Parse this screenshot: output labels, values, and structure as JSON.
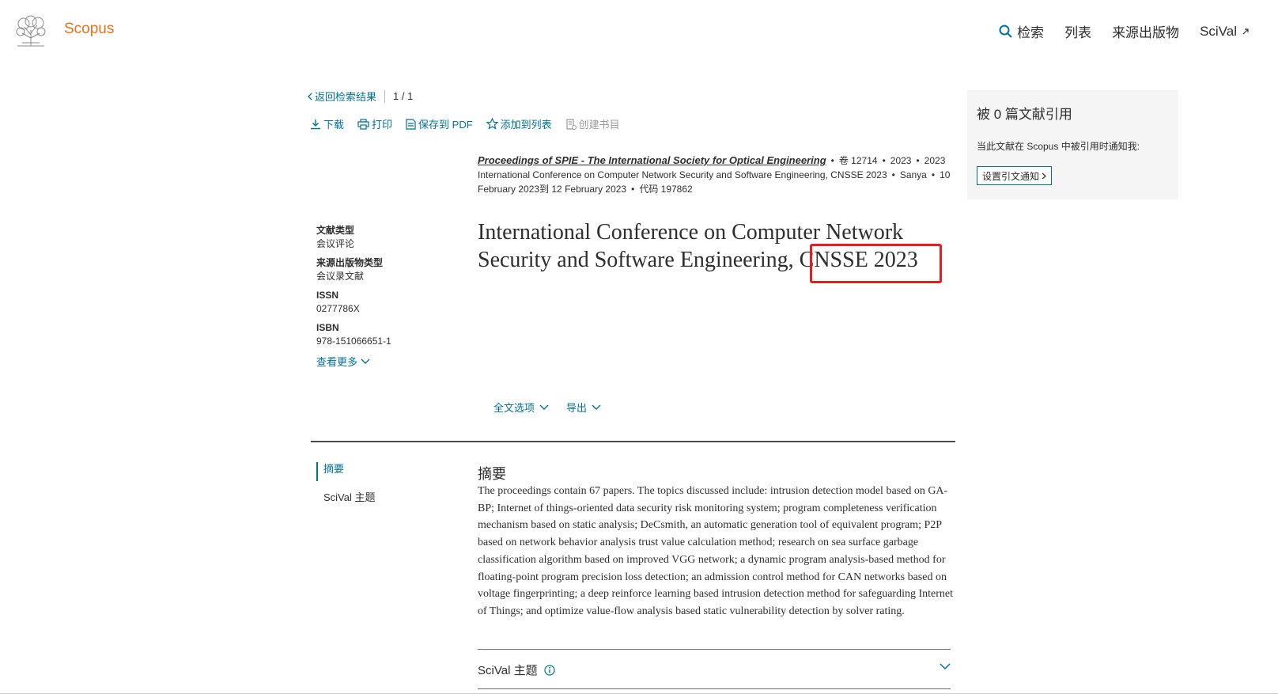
{
  "header": {
    "brand": "Scopus",
    "nav": {
      "search": "检索",
      "lists": "列表",
      "sources": "来源出版物",
      "scival": "SciVal"
    }
  },
  "back": {
    "label": "返回检索结果",
    "pager": "1 / 1"
  },
  "toolbar": {
    "download": "下载",
    "print": "打印",
    "save_pdf": "保存到 PDF",
    "add_list": "添加到列表",
    "create_bib": "创建书目"
  },
  "source": {
    "journal": "Proceedings of SPIE - The International Society for Optical Engineering",
    "volume": "卷 12714",
    "year1": "2023",
    "year2": "2023",
    "conference": "International Conference on Computer Network Security and Software Engineering, CNSSE 2023",
    "location": "Sanya",
    "dates": "10 February 2023到 12 February 2023",
    "code": "代码 197862"
  },
  "meta": {
    "doc_type_label": "文献类型",
    "doc_type": "会议评论",
    "source_type_label": "来源出版物类型",
    "source_type": "会议录文献",
    "issn_label": "ISSN",
    "issn": "0277786X",
    "isbn_label": "ISBN",
    "isbn": "978-151066651-1",
    "more": "查看更多"
  },
  "title": {
    "part1": "International Conference on Computer Network Security and Software Engineering, ",
    "highlight": "CNSSE 2023"
  },
  "options": {
    "fulltext": "全文选项",
    "export": "导出"
  },
  "sidenav": {
    "abstract": "摘要",
    "scival": "SciVal 主题"
  },
  "abstract": {
    "heading": "摘要",
    "text": "The proceedings contain 67 papers. The topics discussed include: intrusion detection model based on GA-BP; Internet of things-oriented data security risk monitoring system; program completeness verification mechanism based on static analysis; DeCsmith, an automatic generation tool of equivalent program; P2P based on network behavior analysis trust value calculation method; research on sea surface garbage classification algorithm based on improved VGG network; a dynamic program analysis-based method for floating-point program precision loss detection; an admission control method for CAN networks based on voltage fingerprinting; a deep reinforce learning based intrusion detection method for safeguarding Internet of Things; and optimize value-flow analysis based static vulnerability detection by solver rating."
  },
  "accordion": {
    "scival_label": "SciVal 主题"
  },
  "panel": {
    "title": "被 0 篇文献引用",
    "text": "当此文献在 Scopus 中被引用时通知我:",
    "button": "设置引文通知"
  },
  "colors": {
    "brand": "#e9711c",
    "link": "#007398",
    "highlight": "#e02020"
  }
}
